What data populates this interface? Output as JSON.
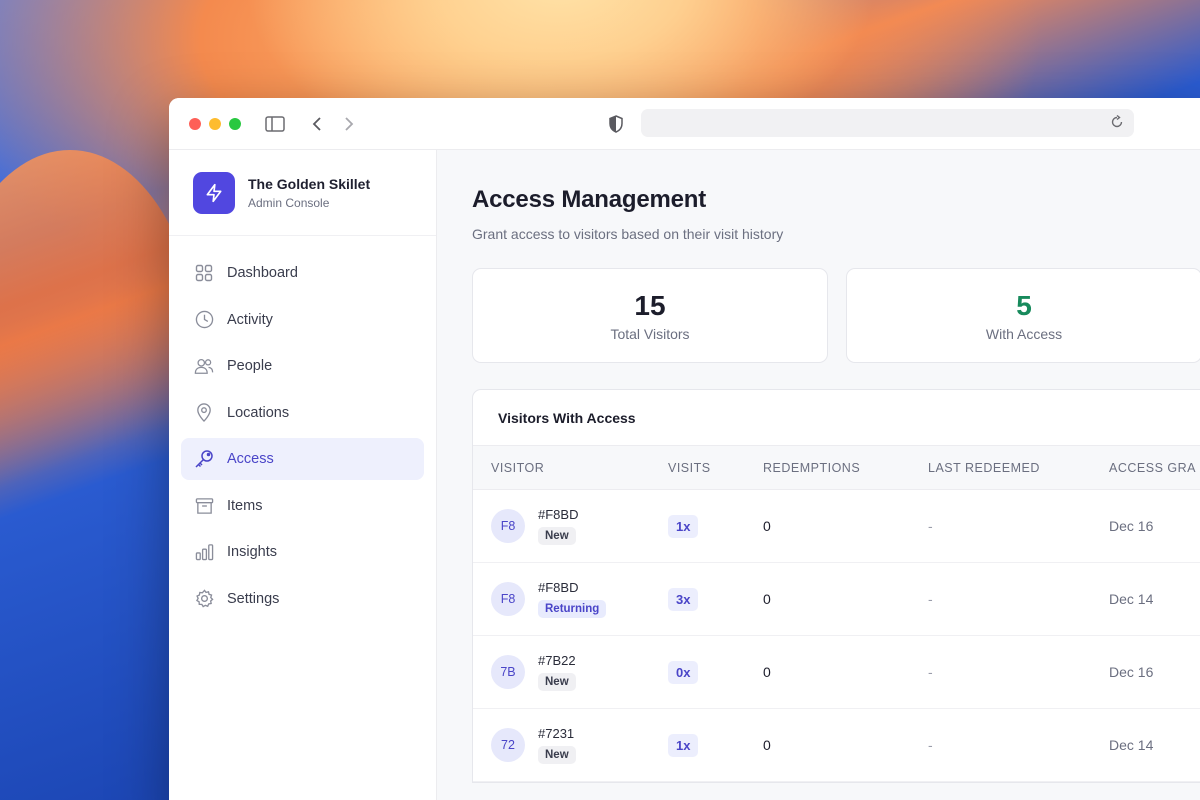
{
  "brand": {
    "name": "The Golden Skillet",
    "subtitle": "Admin Console"
  },
  "nav": [
    {
      "label": "Dashboard",
      "icon": "grid-icon",
      "active": false
    },
    {
      "label": "Activity",
      "icon": "clock-icon",
      "active": false
    },
    {
      "label": "People",
      "icon": "people-icon",
      "active": false
    },
    {
      "label": "Locations",
      "icon": "location-pin-icon",
      "active": false
    },
    {
      "label": "Access",
      "icon": "key-icon",
      "active": true
    },
    {
      "label": "Items",
      "icon": "archive-box-icon",
      "active": false
    },
    {
      "label": "Insights",
      "icon": "bar-chart-icon",
      "active": false
    },
    {
      "label": "Settings",
      "icon": "gear-icon",
      "active": false
    }
  ],
  "page": {
    "title": "Access Management",
    "subtitle": "Grant access to visitors based on their visit history"
  },
  "stats": [
    {
      "value": "15",
      "label": "Total Visitors",
      "color": "#1c1d2b"
    },
    {
      "value": "5",
      "label": "With Access",
      "color": "#178a5c"
    }
  ],
  "table": {
    "title": "Visitors With Access",
    "columns": [
      "VISITOR",
      "VISITS",
      "REDEMPTIONS",
      "LAST REDEEMED",
      "ACCESS GRA"
    ],
    "rows": [
      {
        "initials": "F8",
        "id": "#F8BD",
        "badge": "New",
        "visits": "1x",
        "redemptions": "0",
        "last": "-",
        "granted": "Dec 16"
      },
      {
        "initials": "F8",
        "id": "#F8BD",
        "badge": "Returning",
        "visits": "3x",
        "redemptions": "0",
        "last": "-",
        "granted": "Dec 14"
      },
      {
        "initials": "7B",
        "id": "#7B22",
        "badge": "New",
        "visits": "0x",
        "redemptions": "0",
        "last": "-",
        "granted": "Dec 16"
      },
      {
        "initials": "72",
        "id": "#7231",
        "badge": "New",
        "visits": "1x",
        "redemptions": "0",
        "last": "-",
        "granted": "Dec 14"
      }
    ]
  },
  "colors": {
    "accent": "#5147e0",
    "success": "#178a5c"
  }
}
